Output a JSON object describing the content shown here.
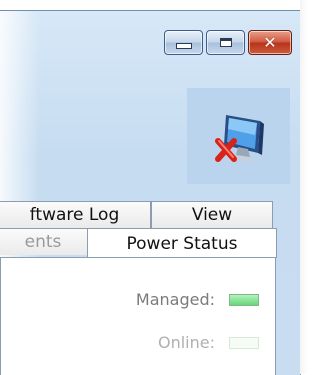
{
  "window": {
    "caption_buttons": [
      {
        "name": "minimize",
        "icon": "minimize-icon"
      },
      {
        "name": "restore",
        "icon": "restore-icon"
      },
      {
        "name": "close",
        "icon": "close-icon",
        "glyph": "✕"
      }
    ]
  },
  "header_icon": "computer-error-icon",
  "tabs_row1": [
    {
      "label": "ftware Log"
    },
    {
      "label": "View"
    }
  ],
  "tabs_row2": [
    {
      "label": "ents"
    },
    {
      "label": "Power Status"
    }
  ],
  "status": {
    "managed_label": "Managed:",
    "managed_state": "on",
    "online_label": "Online:",
    "online_state": "off"
  },
  "colors": {
    "accent_green": "#67d67a",
    "close_red": "#b7341c"
  }
}
